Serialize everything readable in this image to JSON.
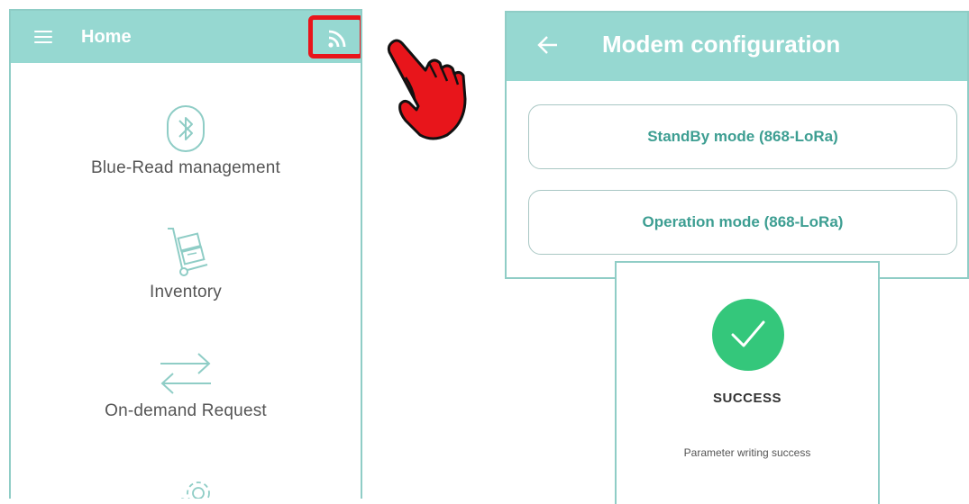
{
  "home_screen": {
    "title": "Home",
    "menu_items": [
      {
        "label": "Blue-Read management",
        "icon": "bluetooth-icon"
      },
      {
        "label": "Inventory",
        "icon": "hand-truck-icon"
      },
      {
        "label": "On-demand Request",
        "icon": "transfer-arrows-icon"
      },
      {
        "icon": "gear-icon"
      }
    ],
    "highlight_color": "#e8151b",
    "topbar_color": "#96d8d1"
  },
  "modem_screen": {
    "title": "Modem configuration",
    "buttons": [
      {
        "label": "StandBy mode (868-LoRa)"
      },
      {
        "label": "Operation mode (868-LoRa)"
      }
    ],
    "button_text_color": "#3d9e92"
  },
  "dialog": {
    "title": "SUCCESS",
    "message": "Parameter writing success",
    "icon": "check-icon",
    "icon_color": "#34c77b"
  }
}
